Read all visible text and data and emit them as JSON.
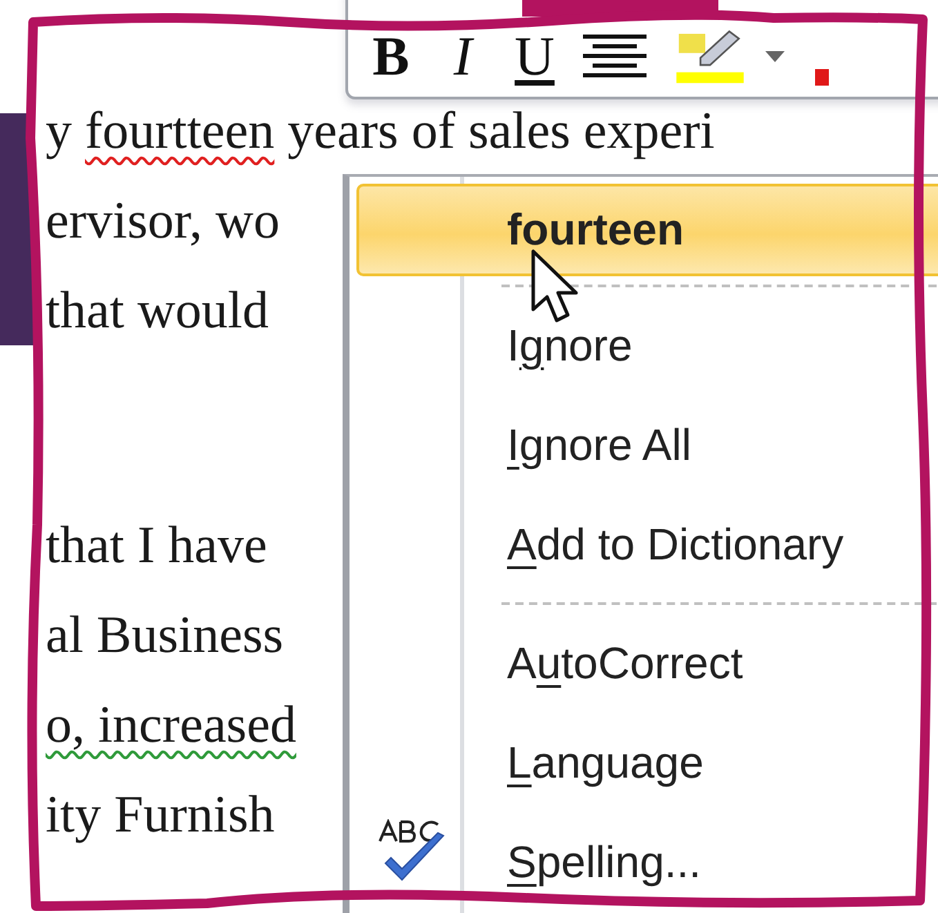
{
  "document": {
    "paragraphs": [
      {
        "lines": [
          {
            "segments": [
              {
                "text": "y "
              },
              {
                "text": "fourtteen",
                "misspelled": true
              },
              {
                "text": " years of sales experi"
              }
            ]
          },
          {
            "segments": [
              {
                "text": "ervisor, wo"
              }
            ]
          },
          {
            "segments": [
              {
                "text": "that would"
              }
            ]
          }
        ]
      },
      {
        "lines": [
          {
            "segments": [
              {
                "text": "that I have"
              }
            ]
          },
          {
            "segments": [
              {
                "text": "al Business"
              }
            ]
          },
          {
            "segments": [
              {
                "text": "o, increased",
                "grammar_issue": true
              }
            ]
          },
          {
            "segments": [
              {
                "text": "ity Furnish"
              }
            ]
          }
        ]
      }
    ]
  },
  "mini_toolbar": {
    "buttons": [
      {
        "kind": "bold",
        "label": "B"
      },
      {
        "kind": "italic",
        "label": "I"
      },
      {
        "kind": "underline",
        "label": "U"
      },
      {
        "kind": "align-center"
      },
      {
        "kind": "highlight",
        "color": "#ffff00"
      },
      {
        "kind": "dropdown"
      }
    ]
  },
  "context_menu": {
    "items": [
      {
        "kind": "suggestion",
        "label": "fourteen",
        "selected": true
      },
      {
        "kind": "separator"
      },
      {
        "kind": "command",
        "label_parts": [
          {
            "text": "I",
            "access_key": false
          },
          {
            "text": "g",
            "access_key": true
          },
          {
            "text": "nore",
            "access_key": false
          }
        ],
        "selected": false
      },
      {
        "kind": "command",
        "label_parts": [
          {
            "text": "I",
            "access_key": true
          },
          {
            "text": "gnore All",
            "access_key": false
          }
        ],
        "selected": false
      },
      {
        "kind": "command",
        "label_parts": [
          {
            "text": "A",
            "access_key": true
          },
          {
            "text": "dd to Dictionary",
            "access_key": false
          }
        ],
        "selected": false
      },
      {
        "kind": "separator"
      },
      {
        "kind": "command",
        "label_parts": [
          {
            "text": "A",
            "access_key": false
          },
          {
            "text": "u",
            "access_key": true
          },
          {
            "text": "toCorrect",
            "access_key": false
          }
        ],
        "selected": false
      },
      {
        "kind": "command",
        "label_parts": [
          {
            "text": "L",
            "access_key": true
          },
          {
            "text": "anguage",
            "access_key": false
          }
        ],
        "selected": false
      },
      {
        "kind": "command",
        "label_parts": [
          {
            "text": "S",
            "access_key": true
          },
          {
            "text": "pelling...",
            "access_key": false
          }
        ],
        "selected": false,
        "has_icon": true
      }
    ]
  }
}
